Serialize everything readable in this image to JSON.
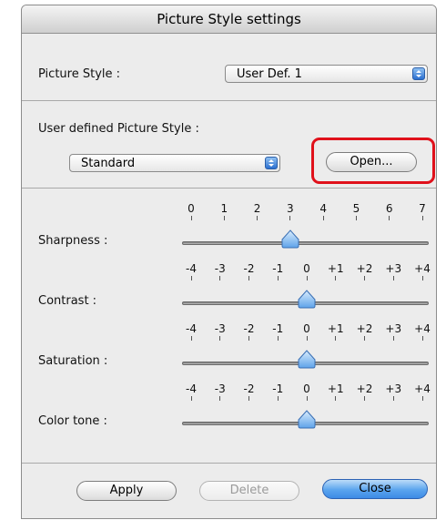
{
  "window": {
    "title": "Picture Style settings"
  },
  "picture_style": {
    "label": "Picture Style :",
    "selected": "User Def. 1"
  },
  "user_defined": {
    "label": "User defined Picture Style :",
    "selected": "Standard",
    "open_button": "Open..."
  },
  "sliders": [
    {
      "label": "Sharpness :",
      "ticks": [
        "0",
        "1",
        "2",
        "3",
        "4",
        "5",
        "6",
        "7"
      ],
      "value": "3"
    },
    {
      "label": "Contrast :",
      "ticks": [
        "-4",
        "-3",
        "-2",
        "-1",
        "0",
        "+1",
        "+2",
        "+3",
        "+4"
      ],
      "value": "0"
    },
    {
      "label": "Saturation :",
      "ticks": [
        "-4",
        "-3",
        "-2",
        "-1",
        "0",
        "+1",
        "+2",
        "+3",
        "+4"
      ],
      "value": "0"
    },
    {
      "label": "Color tone :",
      "ticks": [
        "-4",
        "-3",
        "-2",
        "-1",
        "0",
        "+1",
        "+2",
        "+3",
        "+4"
      ],
      "value": "0"
    }
  ],
  "buttons": {
    "apply": "Apply",
    "delete": "Delete",
    "close": "Close"
  },
  "colors": {
    "highlight": "#e0111b",
    "accent": "#3d8be6"
  },
  "icons": {
    "popup_arrow": "up-down-chevron-icon",
    "slider_thumb": "slider-thumb-icon"
  }
}
